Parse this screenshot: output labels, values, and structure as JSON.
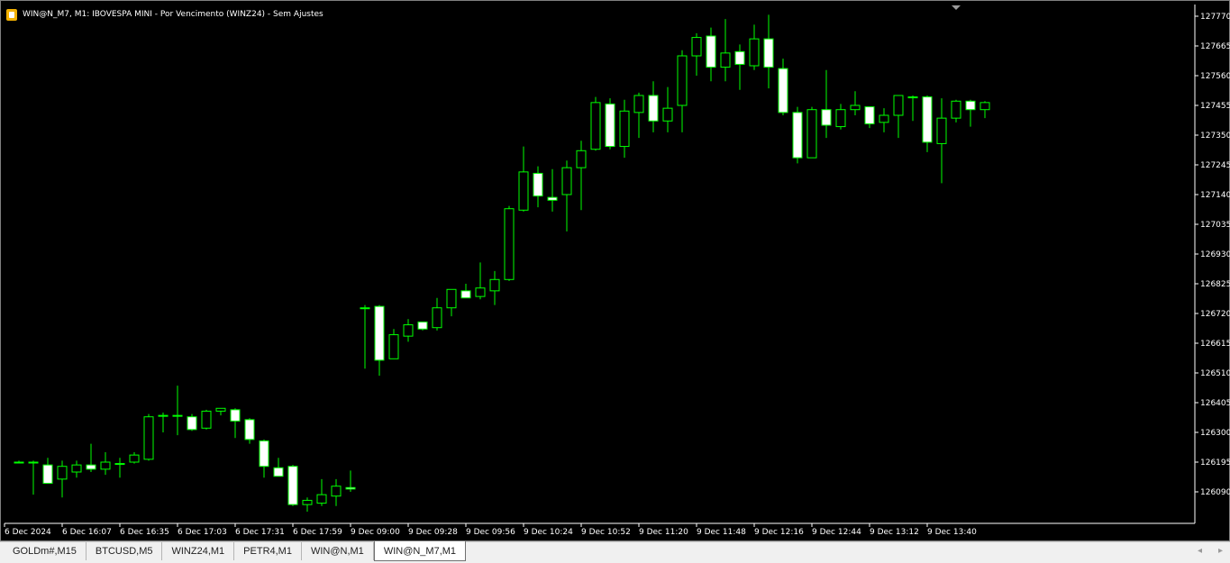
{
  "window": {
    "title": "WIN@N_M7, M1:  IBOVESPA MINI - Por Vencimento (WINZ24) - Sem Ajustes",
    "icon": "document-icon"
  },
  "tabs": [
    {
      "label": "GOLDm#,M15",
      "active": false
    },
    {
      "label": "BTCUSD,M5",
      "active": false
    },
    {
      "label": "WINZ24,M1",
      "active": false
    },
    {
      "label": "PETR4,M1",
      "active": false
    },
    {
      "label": "WIN@N,M1",
      "active": false
    },
    {
      "label": "WIN@N_M7,M1",
      "active": true
    }
  ],
  "tab_nav": {
    "prev": "◂",
    "next": "▸"
  },
  "colors": {
    "background": "#000000",
    "bull_body": "#000000",
    "bear_body": "#ffffff",
    "wick": "#00ff00",
    "axis_text": "#ffffff"
  },
  "chart_data": {
    "type": "candlestick",
    "y_axis_ticks": [
      127770,
      127665,
      127560,
      127455,
      127350,
      127245,
      127140,
      127035,
      126930,
      126825,
      126720,
      126615,
      126510,
      126405,
      126300,
      126195,
      126090
    ],
    "ylim": [
      125990,
      127800
    ],
    "x_axis_labels": [
      {
        "bar": 0,
        "label": "6 Dec 2024"
      },
      {
        "bar": 4,
        "label": "6 Dec 16:07"
      },
      {
        "bar": 8,
        "label": "6 Dec 16:35"
      },
      {
        "bar": 12,
        "label": "6 Dec 17:03"
      },
      {
        "bar": 16,
        "label": "6 Dec 17:31"
      },
      {
        "bar": 20,
        "label": "6 Dec 17:59"
      },
      {
        "bar": 24,
        "label": "9 Dec 09:00"
      },
      {
        "bar": 28,
        "label": "9 Dec 09:28"
      },
      {
        "bar": 32,
        "label": "9 Dec 09:56"
      },
      {
        "bar": 36,
        "label": "9 Dec 10:24"
      },
      {
        "bar": 40,
        "label": "9 Dec 10:52"
      },
      {
        "bar": 44,
        "label": "9 Dec 11:20"
      },
      {
        "bar": 48,
        "label": "9 Dec 11:48"
      },
      {
        "bar": 52,
        "label": "9 Dec 12:16"
      },
      {
        "bar": 56,
        "label": "9 Dec 12:44"
      },
      {
        "bar": 60,
        "label": "9 Dec 13:12"
      },
      {
        "bar": 64,
        "label": "9 Dec 13:40"
      }
    ],
    "candles": [
      {
        "o": 126195,
        "h": 126200,
        "l": 126195,
        "c": 126195
      },
      {
        "o": 126195,
        "h": 126200,
        "l": 126080,
        "c": 126195
      },
      {
        "o": 126185,
        "h": 126210,
        "l": 126120,
        "c": 126120
      },
      {
        "o": 126135,
        "h": 126200,
        "l": 126070,
        "c": 126180
      },
      {
        "o": 126160,
        "h": 126200,
        "l": 126140,
        "c": 126185
      },
      {
        "o": 126185,
        "h": 126260,
        "l": 126160,
        "c": 126170
      },
      {
        "o": 126170,
        "h": 126230,
        "l": 126150,
        "c": 126195
      },
      {
        "o": 126190,
        "h": 126210,
        "l": 126140,
        "c": 126190
      },
      {
        "o": 126195,
        "h": 126230,
        "l": 126190,
        "c": 126220
      },
      {
        "o": 126205,
        "h": 126365,
        "l": 126200,
        "c": 126355
      },
      {
        "o": 126360,
        "h": 126370,
        "l": 126300,
        "c": 126360
      },
      {
        "o": 126360,
        "h": 126465,
        "l": 126290,
        "c": 126360
      },
      {
        "o": 126355,
        "h": 126365,
        "l": 126305,
        "c": 126310
      },
      {
        "o": 126315,
        "h": 126380,
        "l": 126310,
        "c": 126375
      },
      {
        "o": 126375,
        "h": 126385,
        "l": 126360,
        "c": 126385
      },
      {
        "o": 126380,
        "h": 126385,
        "l": 126280,
        "c": 126340
      },
      {
        "o": 126345,
        "h": 126350,
        "l": 126260,
        "c": 126275
      },
      {
        "o": 126270,
        "h": 126275,
        "l": 126140,
        "c": 126180
      },
      {
        "o": 126175,
        "h": 126210,
        "l": 126150,
        "c": 126145
      },
      {
        "o": 126180,
        "h": 126185,
        "l": 126040,
        "c": 126045
      },
      {
        "o": 126045,
        "h": 126070,
        "l": 126020,
        "c": 126060
      },
      {
        "o": 126050,
        "h": 126135,
        "l": 126040,
        "c": 126080
      },
      {
        "o": 126075,
        "h": 126135,
        "l": 126040,
        "c": 126110
      },
      {
        "o": 126105,
        "h": 126165,
        "l": 126090,
        "c": 126100
      },
      {
        "o": 126740,
        "h": 126750,
        "l": 126525,
        "c": 126740
      },
      {
        "o": 126745,
        "h": 126750,
        "l": 126500,
        "c": 126555
      },
      {
        "o": 126560,
        "h": 126665,
        "l": 126560,
        "c": 126645
      },
      {
        "o": 126640,
        "h": 126700,
        "l": 126620,
        "c": 126680
      },
      {
        "o": 126690,
        "h": 126690,
        "l": 126660,
        "c": 126665
      },
      {
        "o": 126670,
        "h": 126775,
        "l": 126660,
        "c": 126740
      },
      {
        "o": 126740,
        "h": 126805,
        "l": 126710,
        "c": 126805
      },
      {
        "o": 126800,
        "h": 126825,
        "l": 126785,
        "c": 126775
      },
      {
        "o": 126780,
        "h": 126900,
        "l": 126770,
        "c": 126810
      },
      {
        "o": 126800,
        "h": 126870,
        "l": 126750,
        "c": 126840
      },
      {
        "o": 126840,
        "h": 127100,
        "l": 126835,
        "c": 127090
      },
      {
        "o": 127085,
        "h": 127310,
        "l": 127080,
        "c": 127220
      },
      {
        "o": 127215,
        "h": 127240,
        "l": 127095,
        "c": 127135
      },
      {
        "o": 127130,
        "h": 127230,
        "l": 127080,
        "c": 127120
      },
      {
        "o": 127140,
        "h": 127260,
        "l": 127010,
        "c": 127235
      },
      {
        "o": 127235,
        "h": 127330,
        "l": 127085,
        "c": 127295
      },
      {
        "o": 127300,
        "h": 127485,
        "l": 127295,
        "c": 127465
      },
      {
        "o": 127460,
        "h": 127480,
        "l": 127300,
        "c": 127310
      },
      {
        "o": 127310,
        "h": 127475,
        "l": 127270,
        "c": 127435
      },
      {
        "o": 127430,
        "h": 127500,
        "l": 127340,
        "c": 127490
      },
      {
        "o": 127490,
        "h": 127540,
        "l": 127360,
        "c": 127400
      },
      {
        "o": 127400,
        "h": 127520,
        "l": 127360,
        "c": 127445
      },
      {
        "o": 127455,
        "h": 127650,
        "l": 127360,
        "c": 127630
      },
      {
        "o": 127630,
        "h": 127710,
        "l": 127560,
        "c": 127695
      },
      {
        "o": 127700,
        "h": 127730,
        "l": 127540,
        "c": 127590
      },
      {
        "o": 127590,
        "h": 127760,
        "l": 127540,
        "c": 127640
      },
      {
        "o": 127645,
        "h": 127670,
        "l": 127510,
        "c": 127600
      },
      {
        "o": 127595,
        "h": 127740,
        "l": 127580,
        "c": 127690
      },
      {
        "o": 127690,
        "h": 127775,
        "l": 127515,
        "c": 127590
      },
      {
        "o": 127585,
        "h": 127620,
        "l": 127420,
        "c": 127430
      },
      {
        "o": 127430,
        "h": 127450,
        "l": 127250,
        "c": 127270
      },
      {
        "o": 127270,
        "h": 127450,
        "l": 127270,
        "c": 127440
      },
      {
        "o": 127440,
        "h": 127580,
        "l": 127340,
        "c": 127385
      },
      {
        "o": 127380,
        "h": 127460,
        "l": 127370,
        "c": 127440
      },
      {
        "o": 127440,
        "h": 127505,
        "l": 127420,
        "c": 127455
      },
      {
        "o": 127450,
        "h": 127450,
        "l": 127375,
        "c": 127390
      },
      {
        "o": 127395,
        "h": 127445,
        "l": 127360,
        "c": 127420
      },
      {
        "o": 127420,
        "h": 127490,
        "l": 127340,
        "c": 127490
      },
      {
        "o": 127485,
        "h": 127490,
        "l": 127400,
        "c": 127485
      },
      {
        "o": 127485,
        "h": 127490,
        "l": 127290,
        "c": 127325
      },
      {
        "o": 127320,
        "h": 127480,
        "l": 127180,
        "c": 127410
      },
      {
        "o": 127410,
        "h": 127475,
        "l": 127395,
        "c": 127470
      },
      {
        "o": 127470,
        "h": 127475,
        "l": 127380,
        "c": 127440
      },
      {
        "o": 127440,
        "h": 127470,
        "l": 127410,
        "c": 127465
      }
    ]
  }
}
